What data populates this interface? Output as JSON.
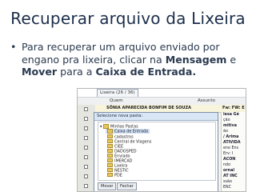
{
  "slide": {
    "title": "Recuperar arquivo da Lixeira",
    "bullet_part1": "Para recuperar um arquivo enviado por engano pra lixeira, clicar na ",
    "bullet_bold1": "Mensagem",
    "bullet_part2": " e ",
    "bullet_bold2": "Mover",
    "bullet_part3": " para a ",
    "bullet_bold3": "Caixa de Entrada."
  },
  "screenshot": {
    "tab_label": "Lixeira (26 / 36)",
    "toolbar": {
      "from_label": "Quem",
      "subject_label": "Assunto"
    },
    "message_row": {
      "sender": "SÔNIA APARECIDA BONFIM DE SOUZA",
      "subject": "Fw: FW: E"
    },
    "right_column": [
      {
        "text": "lesa Gé",
        "bold": true
      },
      {
        "text": "ção",
        "bold": false
      },
      {
        "text": "mitiva",
        "bold": true
      },
      {
        "text": "ão",
        "bold": false
      },
      {
        "text": "/ Arima",
        "bold": true
      },
      {
        "text": "ATIVIDA",
        "bold": true
      },
      {
        "text": "eno Ens",
        "bold": false
      },
      {
        "text": "Erv: I",
        "bold": false
      },
      {
        "text": "ACON",
        "bold": true
      },
      {
        "text": "ndo",
        "bold": false
      },
      {
        "text": "ornal",
        "bold": true
      },
      {
        "text": "AT INC",
        "bold": true
      },
      {
        "text": "ssão",
        "bold": false
      },
      {
        "text": "ENC",
        "bold": false
      }
    ],
    "dialog": {
      "title": "Selecione nova pasta:",
      "folders": [
        "Minhas Pastas",
        "Caixa de Entrada",
        "cadastros",
        "Central de Viagens",
        "CIEE",
        "DADOSPED",
        "Enviado",
        "IMERCAD",
        "Lixeira",
        "NESTIC",
        "PDE"
      ],
      "selected_index": 1,
      "move_button": "Mover",
      "close_button": "Fechar"
    }
  }
}
